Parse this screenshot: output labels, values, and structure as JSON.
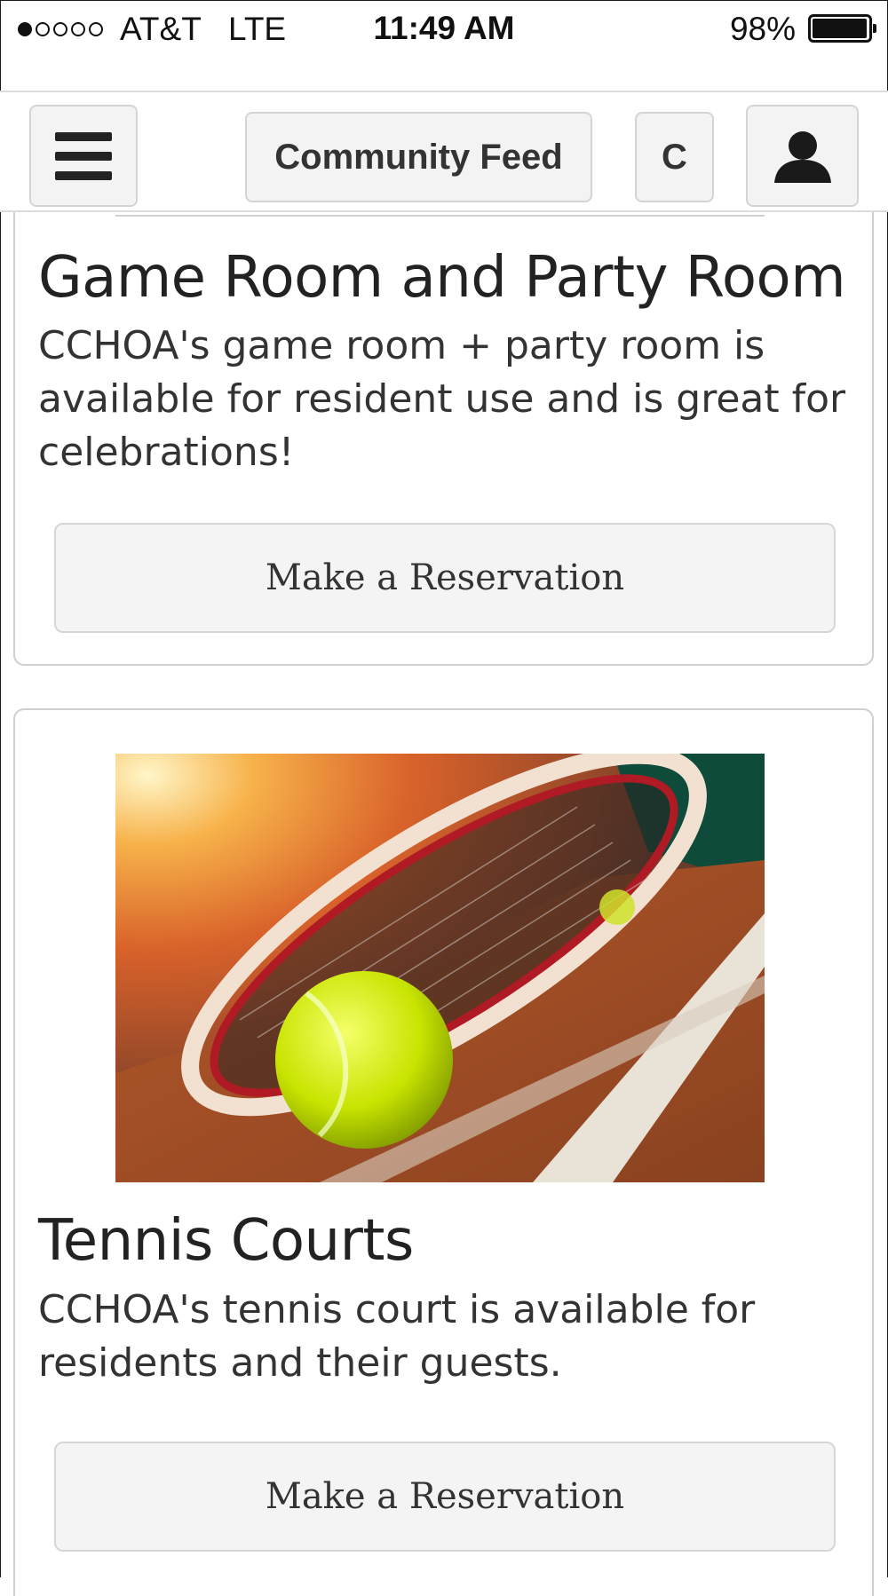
{
  "status_bar": {
    "carrier": "AT&T   LTE",
    "time": "11:49 AM",
    "battery": "98%",
    "battery_level": 0.98,
    "signal_bars_filled": 1,
    "signal_bars_total": 5
  },
  "nav": {
    "menu_icon": "hamburger-menu-icon",
    "feed_label": "Community Feed",
    "c_label": "C",
    "user_icon": "user-avatar-icon"
  },
  "amenities": [
    {
      "title": "Game Room and Party Room",
      "description": "CCHOA's game room + party room is available for resident use and is great for celebrations!",
      "button_label": "Make a Reservation"
    },
    {
      "title": "Tennis Courts",
      "description": "CCHOA's tennis court is available for residents and their guests.",
      "button_label": "Make a Reservation",
      "image": "tennis-racket-and-ball-photo"
    }
  ]
}
